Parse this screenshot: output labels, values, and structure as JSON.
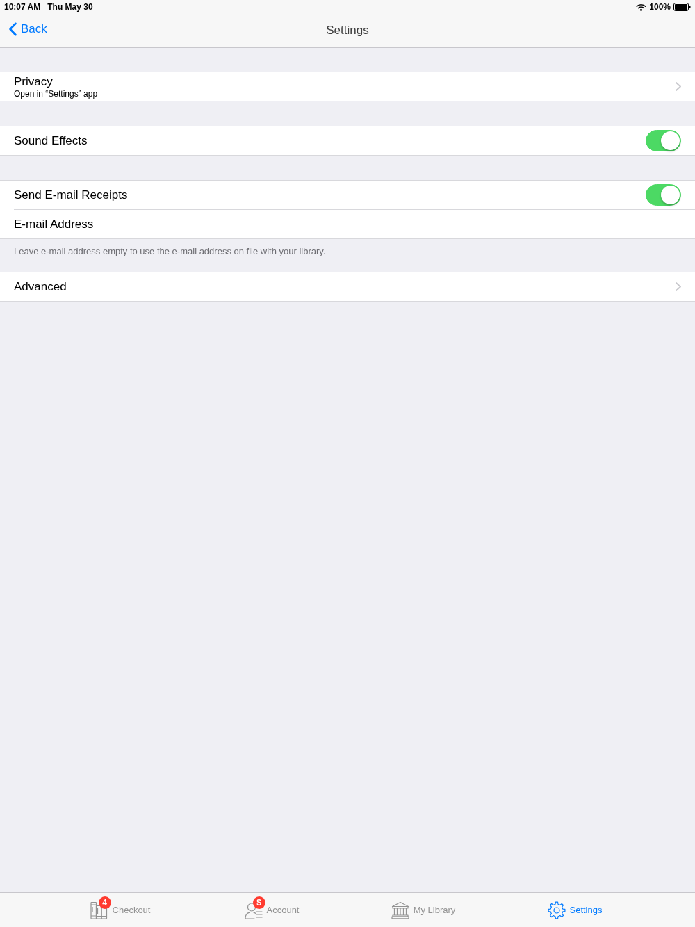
{
  "status_bar": {
    "time": "10:07 AM",
    "date": "Thu May 30",
    "battery": "100%"
  },
  "nav_bar": {
    "back": "Back",
    "title": "Settings"
  },
  "sections": [
    {
      "rows": [
        {
          "kind": "link",
          "label": "Privacy",
          "subtitle": "Open in “Settings” app"
        }
      ]
    },
    {
      "rows": [
        {
          "kind": "toggle",
          "label": "Sound Effects",
          "on": true
        }
      ]
    },
    {
      "rows": [
        {
          "kind": "toggle",
          "label": "Send E-mail Receipts",
          "on": true
        },
        {
          "kind": "text",
          "label": "E-mail Address"
        }
      ],
      "footer": "Leave e-mail address empty to use the e-mail address on file with your library."
    },
    {
      "rows": [
        {
          "kind": "link",
          "label": "Advanced"
        }
      ]
    }
  ],
  "tab_bar": {
    "tabs": [
      {
        "label": "Checkout",
        "badge": "4",
        "selected": false
      },
      {
        "label": "Account",
        "badge": "$",
        "selected": false
      },
      {
        "label": "My Library",
        "selected": false
      },
      {
        "label": "Settings",
        "selected": true
      }
    ]
  }
}
